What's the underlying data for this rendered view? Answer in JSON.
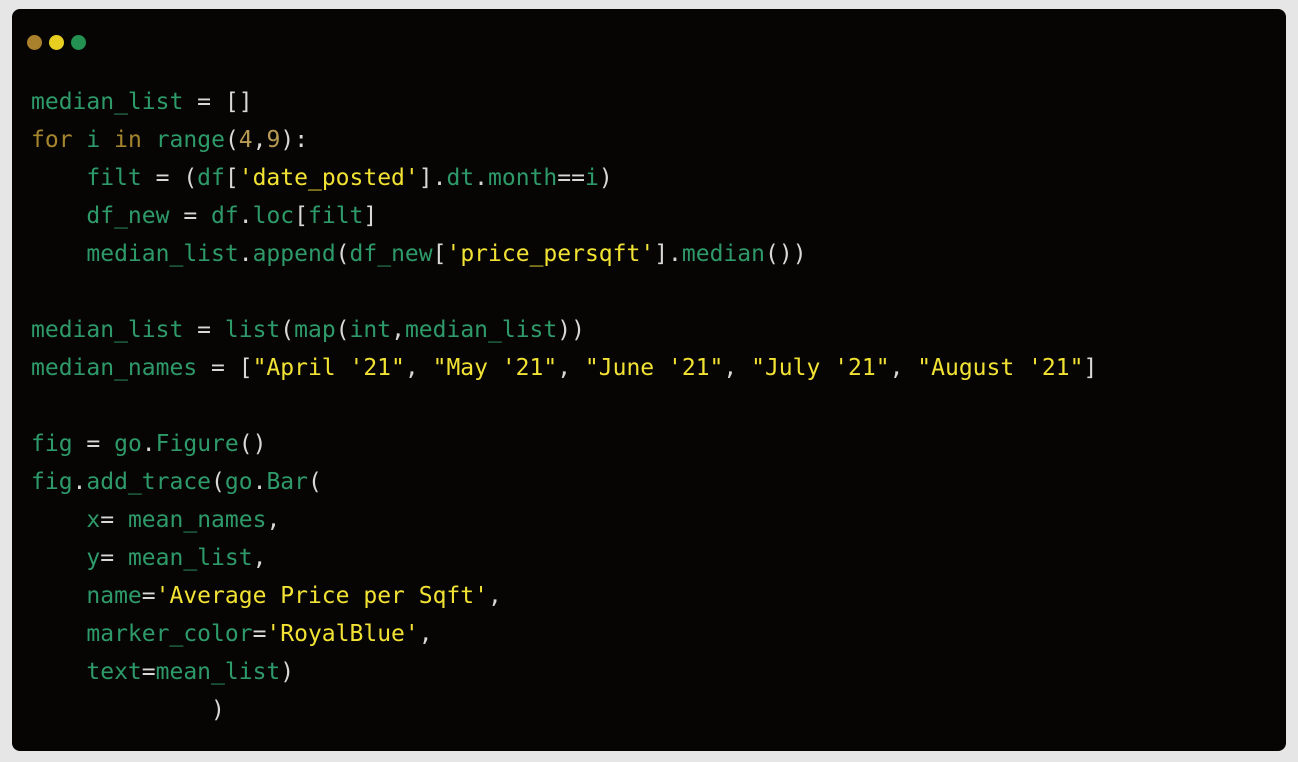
{
  "window": {
    "controls": [
      {
        "name": "close",
        "color": "#a9802b"
      },
      {
        "name": "minimize",
        "color": "#e7ce21"
      },
      {
        "name": "maximize",
        "color": "#23914f"
      }
    ]
  },
  "colors": {
    "background": "#060503",
    "identifier": "#2e9a6a",
    "keyword": "#a6852f",
    "number": "#b89a55",
    "string": "#f2e234",
    "punctuation": "#d8d8d8"
  },
  "code": {
    "lines": [
      [
        [
          "p",
          "median_list"
        ],
        [
          "x",
          " = []"
        ]
      ],
      [
        [
          "k",
          "for"
        ],
        [
          "x",
          " "
        ],
        [
          "p",
          "i"
        ],
        [
          "x",
          " "
        ],
        [
          "k",
          "in"
        ],
        [
          "x",
          " "
        ],
        [
          "p",
          "range"
        ],
        [
          "x",
          "("
        ],
        [
          "n",
          "4"
        ],
        [
          "x",
          ","
        ],
        [
          "n",
          "9"
        ],
        [
          "x",
          "):"
        ]
      ],
      [
        [
          "x",
          "    "
        ],
        [
          "p",
          "filt"
        ],
        [
          "x",
          " = ("
        ],
        [
          "p",
          "df"
        ],
        [
          "x",
          "["
        ],
        [
          "s",
          "'date_posted'"
        ],
        [
          "x",
          "]."
        ],
        [
          "p",
          "dt"
        ],
        [
          "x",
          "."
        ],
        [
          "p",
          "month"
        ],
        [
          "x",
          "=="
        ],
        [
          "p",
          "i"
        ],
        [
          "x",
          ")"
        ]
      ],
      [
        [
          "x",
          "    "
        ],
        [
          "p",
          "df_new"
        ],
        [
          "x",
          " = "
        ],
        [
          "p",
          "df"
        ],
        [
          "x",
          "."
        ],
        [
          "p",
          "loc"
        ],
        [
          "x",
          "["
        ],
        [
          "p",
          "filt"
        ],
        [
          "x",
          "]"
        ]
      ],
      [
        [
          "x",
          "    "
        ],
        [
          "p",
          "median_list"
        ],
        [
          "x",
          "."
        ],
        [
          "p",
          "append"
        ],
        [
          "x",
          "("
        ],
        [
          "p",
          "df_new"
        ],
        [
          "x",
          "["
        ],
        [
          "s",
          "'price_persqft'"
        ],
        [
          "x",
          "]."
        ],
        [
          "p",
          "median"
        ],
        [
          "x",
          "())"
        ]
      ],
      [],
      [
        [
          "p",
          "median_list"
        ],
        [
          "x",
          " = "
        ],
        [
          "p",
          "list"
        ],
        [
          "x",
          "("
        ],
        [
          "p",
          "map"
        ],
        [
          "x",
          "("
        ],
        [
          "p",
          "int"
        ],
        [
          "x",
          ","
        ],
        [
          "p",
          "median_list"
        ],
        [
          "x",
          "))"
        ]
      ],
      [
        [
          "p",
          "median_names"
        ],
        [
          "x",
          " = ["
        ],
        [
          "s",
          "\"April '21\""
        ],
        [
          "x",
          ", "
        ],
        [
          "s",
          "\"May '21\""
        ],
        [
          "x",
          ", "
        ],
        [
          "s",
          "\"June '21\""
        ],
        [
          "x",
          ", "
        ],
        [
          "s",
          "\"July '21\""
        ],
        [
          "x",
          ", "
        ],
        [
          "s",
          "\"August '21\""
        ],
        [
          "x",
          "]"
        ]
      ],
      [],
      [
        [
          "p",
          "fig"
        ],
        [
          "x",
          " = "
        ],
        [
          "p",
          "go"
        ],
        [
          "x",
          "."
        ],
        [
          "p",
          "Figure"
        ],
        [
          "x",
          "()"
        ]
      ],
      [
        [
          "p",
          "fig"
        ],
        [
          "x",
          "."
        ],
        [
          "p",
          "add_trace"
        ],
        [
          "x",
          "("
        ],
        [
          "p",
          "go"
        ],
        [
          "x",
          "."
        ],
        [
          "p",
          "Bar"
        ],
        [
          "x",
          "("
        ]
      ],
      [
        [
          "x",
          "    "
        ],
        [
          "p",
          "x"
        ],
        [
          "x",
          "= "
        ],
        [
          "p",
          "mean_names"
        ],
        [
          "x",
          ","
        ]
      ],
      [
        [
          "x",
          "    "
        ],
        [
          "p",
          "y"
        ],
        [
          "x",
          "= "
        ],
        [
          "p",
          "mean_list"
        ],
        [
          "x",
          ","
        ]
      ],
      [
        [
          "x",
          "    "
        ],
        [
          "p",
          "name"
        ],
        [
          "x",
          "="
        ],
        [
          "s",
          "'Average Price per Sqft'"
        ],
        [
          "x",
          ","
        ]
      ],
      [
        [
          "x",
          "    "
        ],
        [
          "p",
          "marker_color"
        ],
        [
          "x",
          "="
        ],
        [
          "s",
          "'RoyalBlue'"
        ],
        [
          "x",
          ","
        ]
      ],
      [
        [
          "x",
          "    "
        ],
        [
          "p",
          "text"
        ],
        [
          "x",
          "="
        ],
        [
          "p",
          "mean_list"
        ],
        [
          "x",
          ")"
        ]
      ],
      [
        [
          "x",
          "             )"
        ]
      ]
    ]
  }
}
